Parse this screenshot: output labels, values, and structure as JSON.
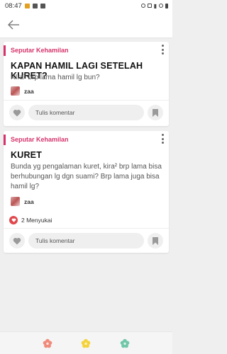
{
  "status_bar": {
    "time": "08:47",
    "icons": [
      "alert-icon",
      "photo-icon",
      "notification-icon",
      "alarm-icon",
      "vibrate-icon",
      "signal-icon",
      "dnd-icon",
      "battery-icon"
    ]
  },
  "app_bar": {
    "back_icon": "back-arrow-icon"
  },
  "posts": [
    {
      "category": "Seputar Kehamilan",
      "title": "KAPAN HAMIL LAGI SETELAH KURET?",
      "body": "KIra² brp lama hamil lg bun?",
      "author": "zaa",
      "likes_text": "",
      "comment_placeholder": "Tulis komentar"
    },
    {
      "category": "Seputar Kehamilan",
      "title": "KURET",
      "body": "Bunda yg pengalaman kuret, kira² brp lama bisa berhubungan lg dgn suami? Brp lama juga bisa hamil lg?",
      "author": "zaa",
      "likes_text": "2 Menyukai",
      "comment_placeholder": "Tulis komentar"
    }
  ],
  "bottom_nav": {
    "items": [
      "flower-pink-icon",
      "flower-yellow-icon",
      "flower-green-icon"
    ]
  },
  "colors": {
    "accent": "#d6336c",
    "like": "#e0474c",
    "nav_pink": "#f08a7a",
    "nav_yellow": "#f4d23a",
    "nav_green": "#6fc7a8"
  }
}
